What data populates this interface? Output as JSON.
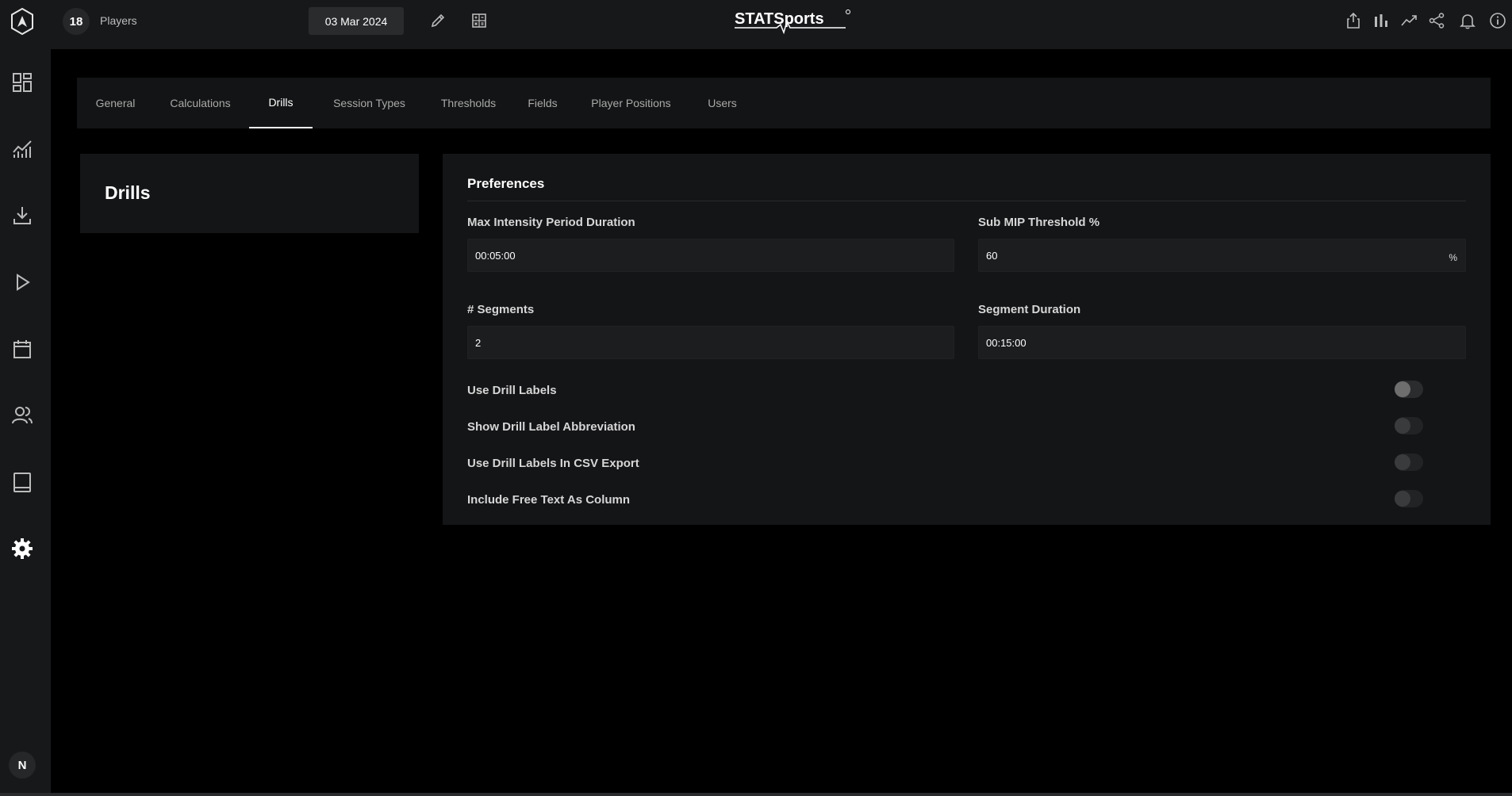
{
  "topbar": {
    "player_count": "18",
    "players_label": "Players",
    "date": "03 Mar 2024",
    "brand": "STATSports"
  },
  "sidebar": {
    "items": [
      {
        "icon": "dashboard-icon"
      },
      {
        "icon": "analytics-icon"
      },
      {
        "icon": "download-icon"
      },
      {
        "icon": "play-icon"
      },
      {
        "icon": "calendar-icon"
      },
      {
        "icon": "users-icon"
      },
      {
        "icon": "tablet-icon"
      },
      {
        "icon": "settings-icon"
      }
    ],
    "avatar": "N"
  },
  "tabs": [
    {
      "label": "General"
    },
    {
      "label": "Calculations"
    },
    {
      "label": "Drills",
      "active": true
    },
    {
      "label": "Session Types"
    },
    {
      "label": "Thresholds"
    },
    {
      "label": "Fields"
    },
    {
      "label": "Player Positions"
    },
    {
      "label": "Users"
    }
  ],
  "left_panel": {
    "title": "Drills"
  },
  "preferences": {
    "title": "Preferences",
    "max_intensity": {
      "label": "Max Intensity Period Duration",
      "value": "00:05:00"
    },
    "sub_mip": {
      "label": "Sub MIP Threshold %",
      "value": "60",
      "suffix": "%"
    },
    "segments": {
      "label": "# Segments",
      "value": "2"
    },
    "segment_duration": {
      "label": "Segment Duration",
      "value": "00:15:00"
    },
    "toggles": [
      {
        "label": "Use Drill Labels",
        "on": false
      },
      {
        "label": "Show Drill Label Abbreviation",
        "on": false
      },
      {
        "label": "Use Drill Labels In CSV Export",
        "on": false
      },
      {
        "label": "Include Free Text As Column",
        "on": false
      }
    ]
  }
}
